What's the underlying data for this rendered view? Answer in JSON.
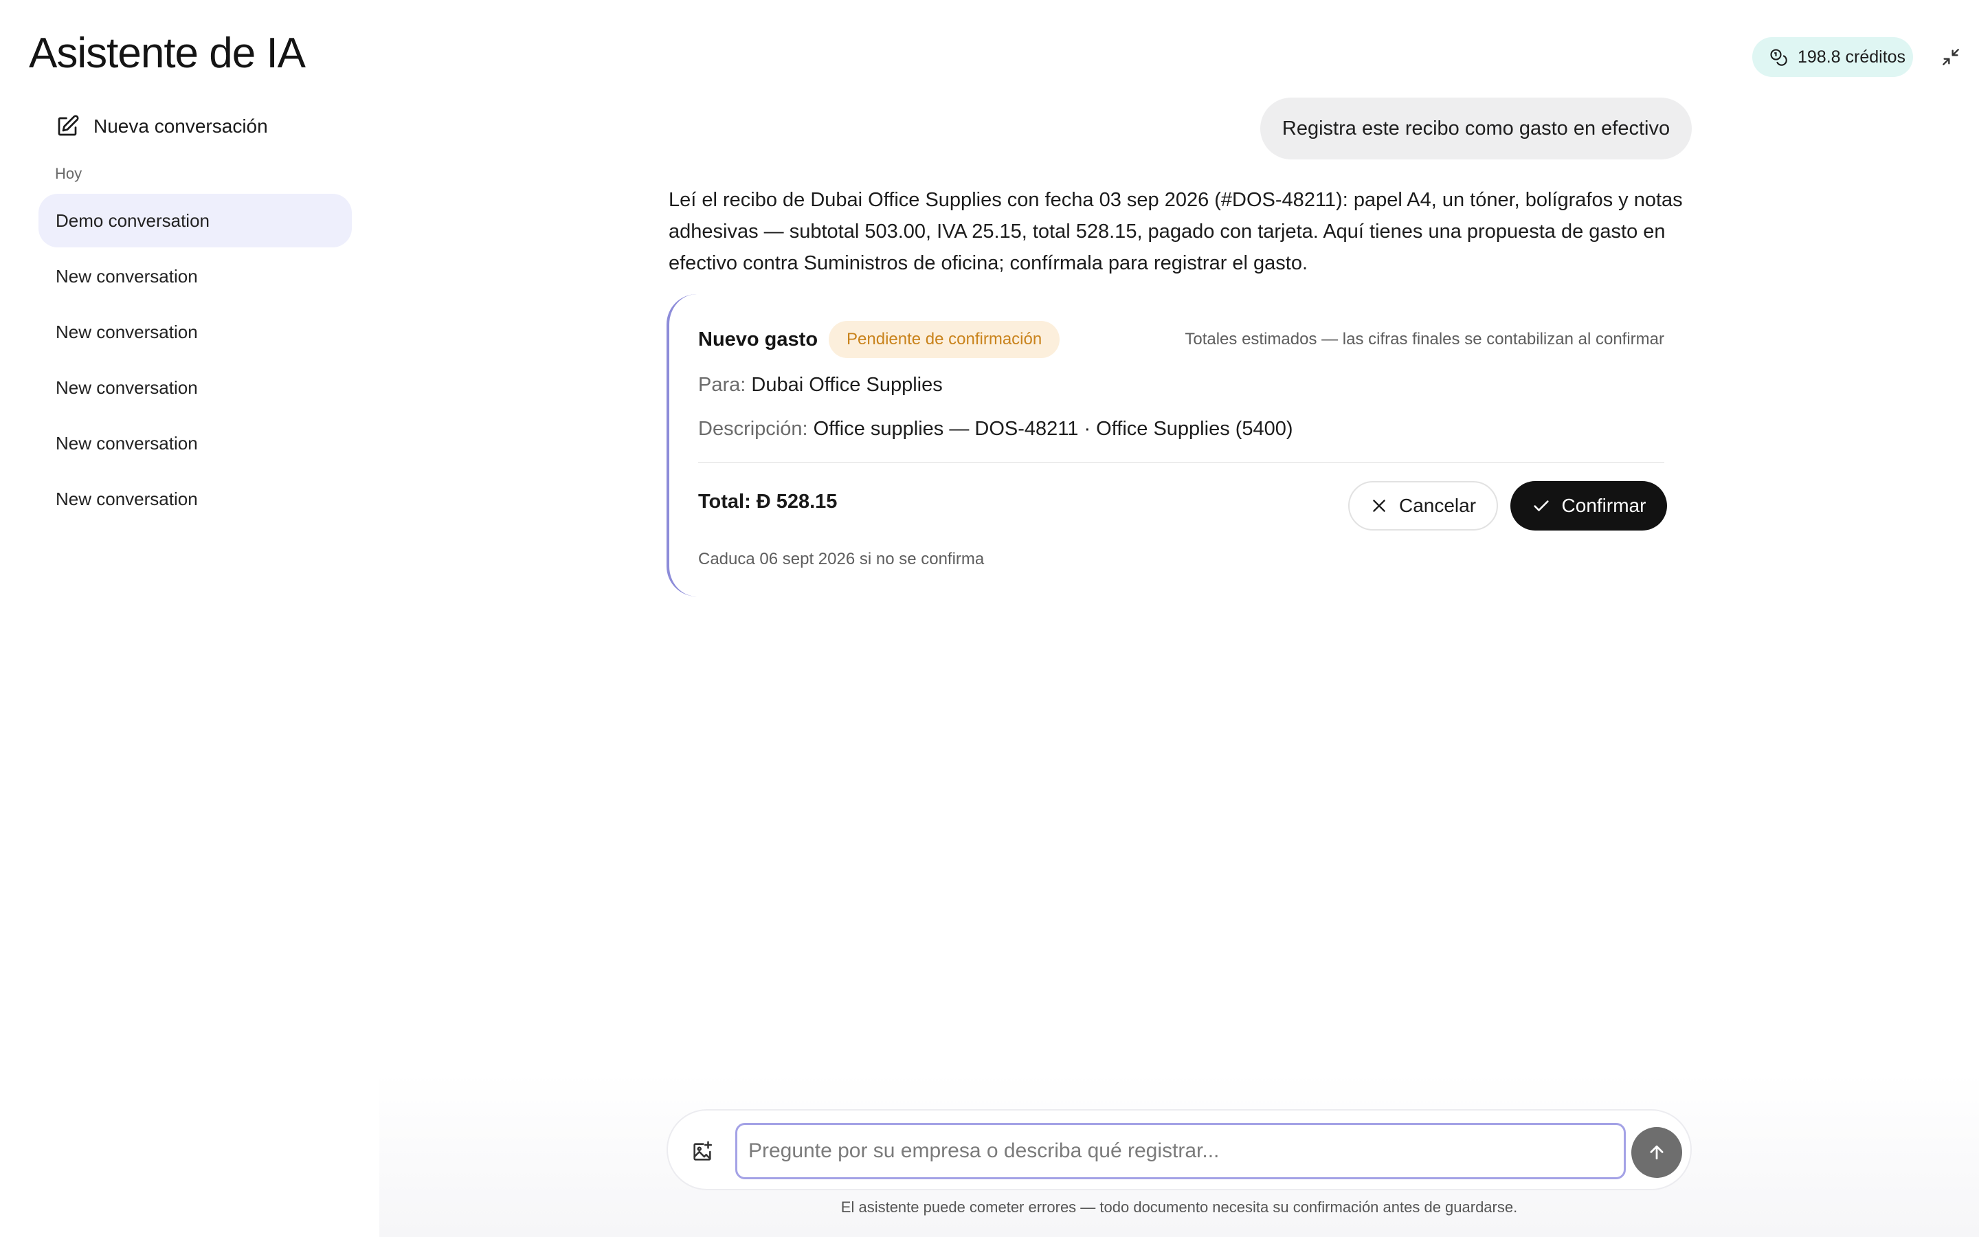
{
  "header": {
    "title": "Asistente de IA",
    "credits": "198.8 créditos"
  },
  "sidebar": {
    "new_conversation": "Nueva conversación",
    "section_label": "Hoy",
    "items": [
      {
        "label": "Demo conversation",
        "active": true
      },
      {
        "label": "New conversation",
        "active": false
      },
      {
        "label": "New conversation",
        "active": false
      },
      {
        "label": "New conversation",
        "active": false
      },
      {
        "label": "New conversation",
        "active": false
      },
      {
        "label": "New conversation",
        "active": false
      }
    ]
  },
  "chat": {
    "user_message": "Registra este recibo como gasto en efectivo",
    "assistant_message": "Leí el recibo de Dubai Office Supplies con fecha 03 sep 2026 (#DOS-48211): papel A4, un tóner, bolígrafos y notas adhesivas — subtotal 503.00, IVA 25.15, total 528.15, pagado con tarjeta. Aquí tienes una propuesta de gasto en efectivo contra Suministros de oficina; confírmala para registrar el gasto."
  },
  "proposal": {
    "title": "Nuevo gasto",
    "status": "Pendiente de confirmación",
    "estimate_note": "Totales estimados — las cifras finales se contabilizan al confirmar",
    "to_label": "Para:",
    "to_value": "Dubai Office Supplies",
    "desc_label": "Descripción:",
    "desc_value": "Office supplies — DOS-48211 · Office Supplies (5400)",
    "total_label": "Total:",
    "currency_symbol": "Đ",
    "total_value": "528.15",
    "cancel_label": "Cancelar",
    "confirm_label": "Confirmar",
    "expires": "Caduca 06 sept 2026 si no se confirma"
  },
  "composer": {
    "placeholder": "Pregunte por su empresa o describa qué registrar...",
    "value": "",
    "disclaimer": "El asistente puede cometer errores — todo documento necesita su confirmación antes de guardarse."
  },
  "colors": {
    "credits_bg": "#dff6f3",
    "active_item_bg": "#eeeffc",
    "badge_bg": "#fcefdc",
    "badge_text": "#c9831c",
    "card_accent": "#8d8cd9",
    "primary_button": "#121212",
    "send_button": "#6e6e6e"
  },
  "icons": {
    "credits": "coins-icon",
    "minimize": "minimize-icon",
    "new_conversation": "edit-icon",
    "cancel": "close-icon",
    "confirm": "check-icon",
    "attach": "image-plus-icon",
    "send": "arrow-up-icon"
  }
}
